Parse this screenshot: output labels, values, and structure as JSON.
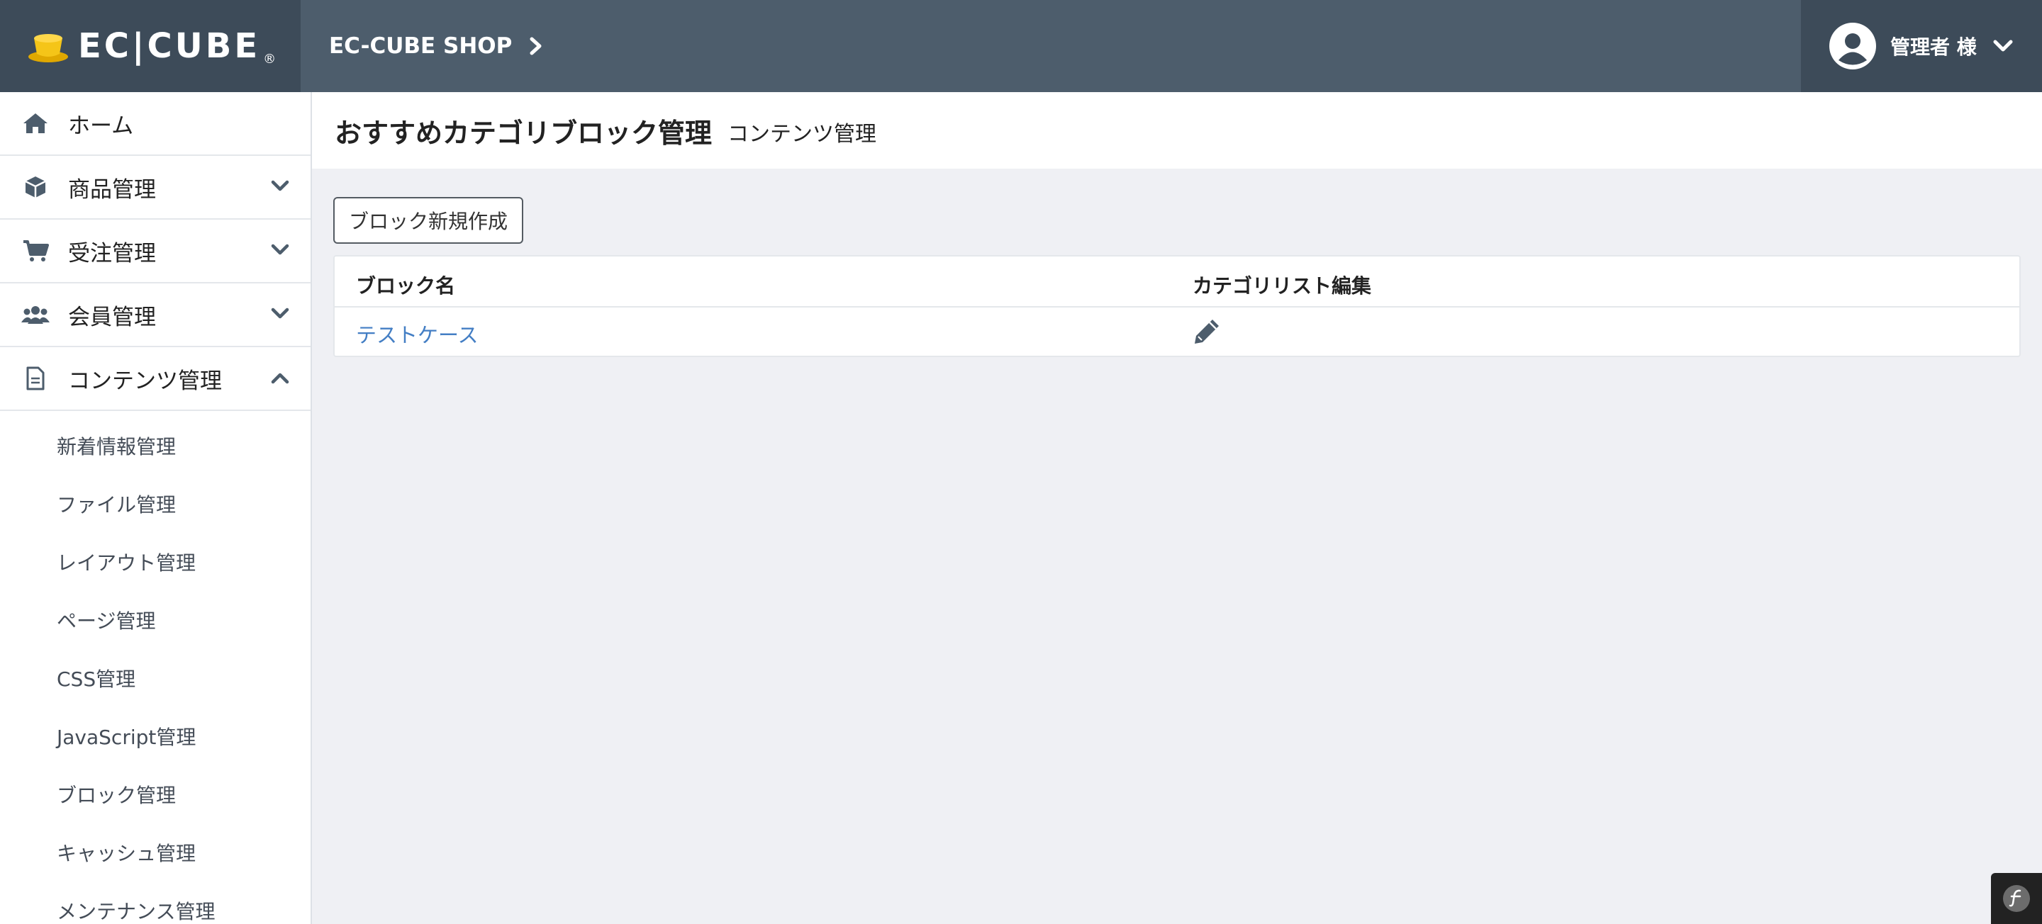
{
  "header": {
    "logo_text": "EC|CUBE",
    "logo_reg": "®",
    "shop_name": "EC-CUBE SHOP",
    "user_name": "管理者 様"
  },
  "sidebar": {
    "items": [
      {
        "label": "ホーム",
        "icon": "home-icon",
        "expanded": null
      },
      {
        "label": "商品管理",
        "icon": "box-icon",
        "expanded": false
      },
      {
        "label": "受注管理",
        "icon": "cart-icon",
        "expanded": false
      },
      {
        "label": "会員管理",
        "icon": "users-icon",
        "expanded": false
      },
      {
        "label": "コンテンツ管理",
        "icon": "document-icon",
        "expanded": true
      }
    ],
    "subitems": [
      "新着情報管理",
      "ファイル管理",
      "レイアウト管理",
      "ページ管理",
      "CSS管理",
      "JavaScript管理",
      "ブロック管理",
      "キャッシュ管理",
      "メンテナンス管理"
    ]
  },
  "page": {
    "title": "おすすめカテゴリブロック管理",
    "subtitle": "コンテンツ管理",
    "new_button": "ブロック新規作成"
  },
  "table": {
    "headers": [
      "ブロック名",
      "カテゴリリスト編集"
    ],
    "rows": [
      {
        "name": "テストケース",
        "edit_icon": "pencil-icon"
      }
    ]
  },
  "colors": {
    "header_bg": "#4D5D6C",
    "header_dark": "#3D4B59",
    "link": "#437EC4",
    "page_bg": "#EFF0F4",
    "logo_cup": "#F0C419"
  }
}
